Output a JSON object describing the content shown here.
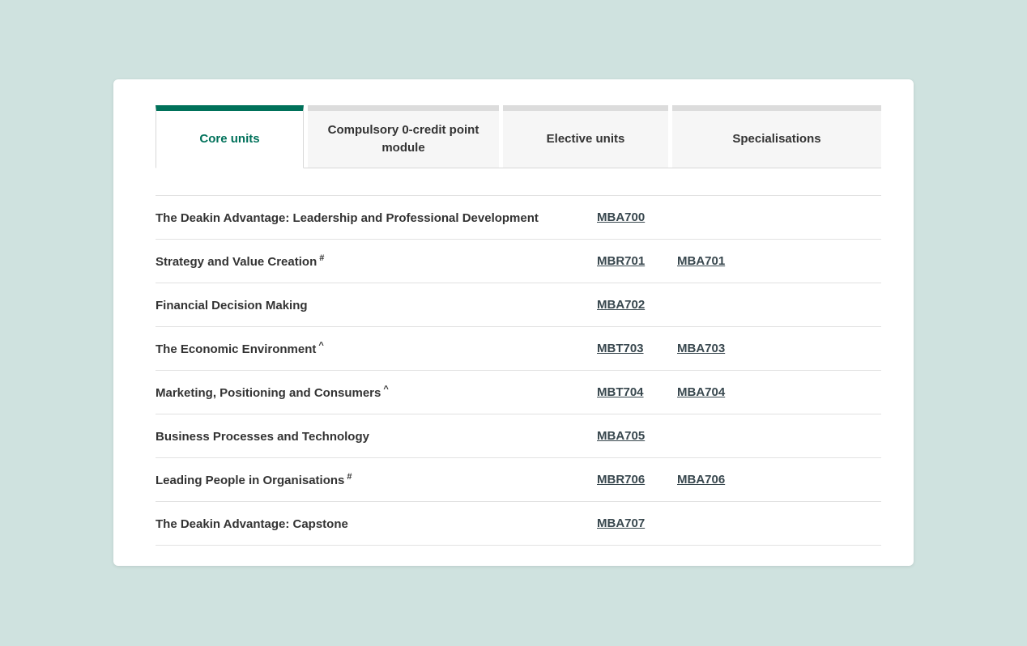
{
  "colors": {
    "page_background": "#cfe2df",
    "card_background": "#ffffff",
    "accent_green": "#00715a",
    "inactive_tab_background": "#f6f6f6",
    "inactive_tab_strip": "#dcdcdc",
    "text": "#333333",
    "link": "#38474e",
    "divider": "#e2e2e2"
  },
  "tabs": [
    {
      "label": "Core units",
      "active": true
    },
    {
      "label": "Compulsory 0-credit point module",
      "active": false
    },
    {
      "label": "Elective units",
      "active": false
    },
    {
      "label": "Specialisations",
      "active": false
    }
  ],
  "units": [
    {
      "name": "The Deakin Advantage: Leadership and Professional Development",
      "superscript": "",
      "codes": [
        "MBA700"
      ]
    },
    {
      "name": "Strategy and Value Creation",
      "superscript": "#",
      "codes": [
        "MBR701",
        "MBA701"
      ]
    },
    {
      "name": "Financial Decision Making",
      "superscript": "",
      "codes": [
        "MBA702"
      ]
    },
    {
      "name": "The Economic Environment",
      "superscript": "^",
      "codes": [
        "MBT703",
        "MBA703"
      ]
    },
    {
      "name": "Marketing, Positioning and Consumers",
      "superscript": "^",
      "codes": [
        "MBT704",
        "MBA704"
      ]
    },
    {
      "name": "Business Processes and Technology",
      "superscript": "",
      "codes": [
        "MBA705"
      ]
    },
    {
      "name": "Leading People in Organisations",
      "superscript": "#",
      "codes": [
        "MBR706",
        "MBA706"
      ]
    },
    {
      "name": "The Deakin Advantage: Capstone",
      "superscript": "",
      "codes": [
        "MBA707"
      ]
    }
  ]
}
